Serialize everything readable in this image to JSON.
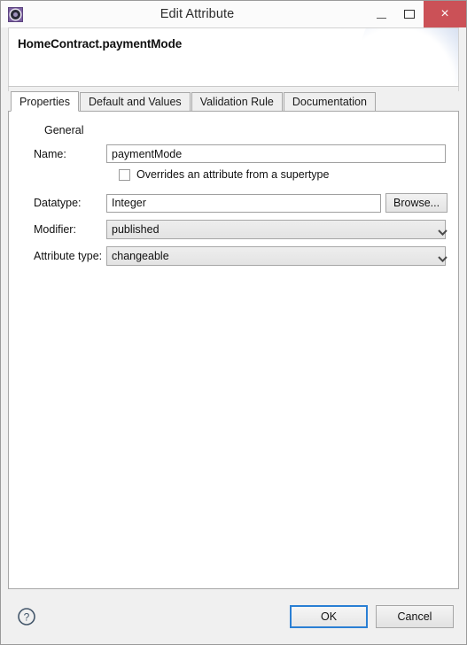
{
  "window": {
    "title": "Edit Attribute",
    "icon": "gear-icon",
    "controls": {
      "minimize": "–",
      "maximize": "□",
      "close": "×"
    }
  },
  "header": {
    "heading": "HomeContract.paymentMode"
  },
  "tabs": [
    {
      "label": "Properties",
      "active": true
    },
    {
      "label": "Default and Values",
      "active": false
    },
    {
      "label": "Validation Rule",
      "active": false
    },
    {
      "label": "Documentation",
      "active": false
    }
  ],
  "form": {
    "group_label": "General",
    "name": {
      "label": "Name:",
      "value": "paymentMode",
      "placeholder": ""
    },
    "overrides": {
      "label": "Overrides an attribute from a supertype",
      "checked": false
    },
    "datatype": {
      "label": "Datatype:",
      "value": "Integer",
      "placeholder": "",
      "browse_label": "Browse..."
    },
    "modifier": {
      "label": "Modifier:",
      "value": "published"
    },
    "attribute_type": {
      "label": "Attribute type:",
      "value": "changeable"
    }
  },
  "footer": {
    "help_icon": "help-circle-icon",
    "ok_label": "OK",
    "cancel_label": "Cancel"
  },
  "colors": {
    "close_button": "#cb5157",
    "default_button_focus": "#2a7fd4",
    "title_icon": "#7b5fa0",
    "header_bubble": "#c6d3ec",
    "dialog_background": "#f0f0f0"
  }
}
